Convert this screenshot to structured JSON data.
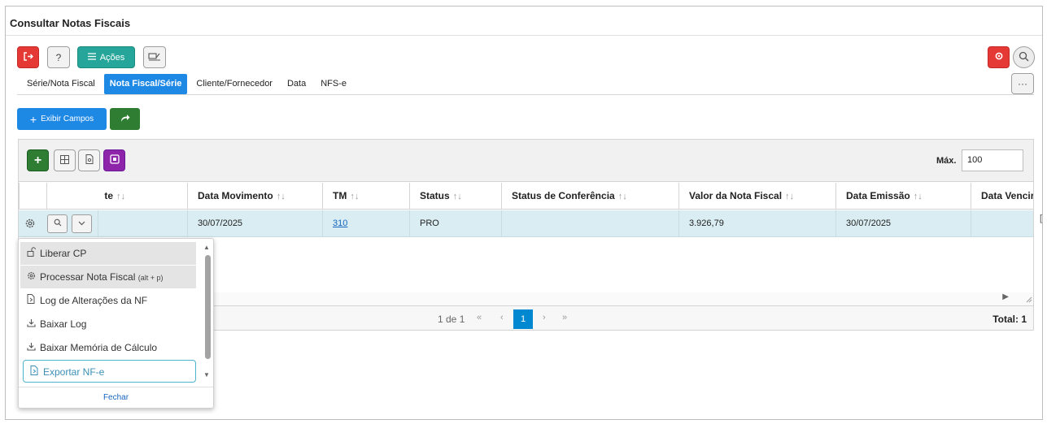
{
  "window": {
    "title": "Consultar Notas Fiscais"
  },
  "toolbar": {
    "exit_icon": "exit-icon",
    "help_label": "?",
    "acoes_label": "Ações",
    "sign_icon": "signature-icon",
    "settings_icon": "gear-icon",
    "search_icon": "search-icon",
    "more_label": "···"
  },
  "tabs": [
    {
      "label": "Série/Nota Fiscal",
      "active": false
    },
    {
      "label": "Nota Fiscal/Série",
      "active": true
    },
    {
      "label": "Cliente/Fornecedor",
      "active": false
    },
    {
      "label": "Data",
      "active": false
    },
    {
      "label": "NFS-e",
      "active": false
    }
  ],
  "actions": {
    "exibir_campos_label": "Exibir Campos",
    "share_icon": "share-icon"
  },
  "grid": {
    "max_label": "Máx.",
    "max_value": "100",
    "columns": [
      {
        "label": "te",
        "sort": "↑↓"
      },
      {
        "label": "Data Movimento",
        "sort": "↑↓"
      },
      {
        "label": "TM",
        "sort": "↑↓"
      },
      {
        "label": "Status",
        "sort": "↑↓"
      },
      {
        "label": "Status de Conferência",
        "sort": "↑↓"
      },
      {
        "label": "Valor da Nota Fiscal",
        "sort": "↑↓"
      },
      {
        "label": "Data Emissão",
        "sort": "↑↓"
      },
      {
        "label": "Data Vencir",
        "sort": ""
      }
    ],
    "rows": [
      {
        "col1": "",
        "data_movimento": "30/07/2025",
        "tm": "310",
        "status": "PRO",
        "status_conferencia": "",
        "valor": "3.926,79",
        "data_emissao": "30/07/2025",
        "data_vencimento": ""
      }
    ]
  },
  "pager": {
    "info": "1 de 1",
    "first": "«",
    "prev": "‹",
    "current": "1",
    "next": "›",
    "last": "»",
    "total": "Total: 1"
  },
  "row_menu": {
    "items": [
      {
        "label": "Liberar CP",
        "hint": "",
        "icon": "unlock-icon"
      },
      {
        "label": "Processar Nota Fiscal",
        "hint": "(alt + p)",
        "icon": "gear-icon"
      },
      {
        "label": "Log de Alterações da NF",
        "hint": "",
        "icon": "log-icon"
      },
      {
        "label": "Baixar Log",
        "hint": "",
        "icon": "download-icon"
      },
      {
        "label": "Baixar Memória de Cálculo",
        "hint": "",
        "icon": "download-icon"
      },
      {
        "label": "Exportar NF-e",
        "hint": "",
        "icon": "export-icon"
      }
    ],
    "close_label": "Fechar"
  },
  "colors": {
    "accent_blue": "#1e88e5",
    "danger_red": "#e53935",
    "teal": "#26a69a",
    "green": "#2e7d32",
    "purple": "#8e24aa",
    "row_highlight": "#d9edf3"
  }
}
